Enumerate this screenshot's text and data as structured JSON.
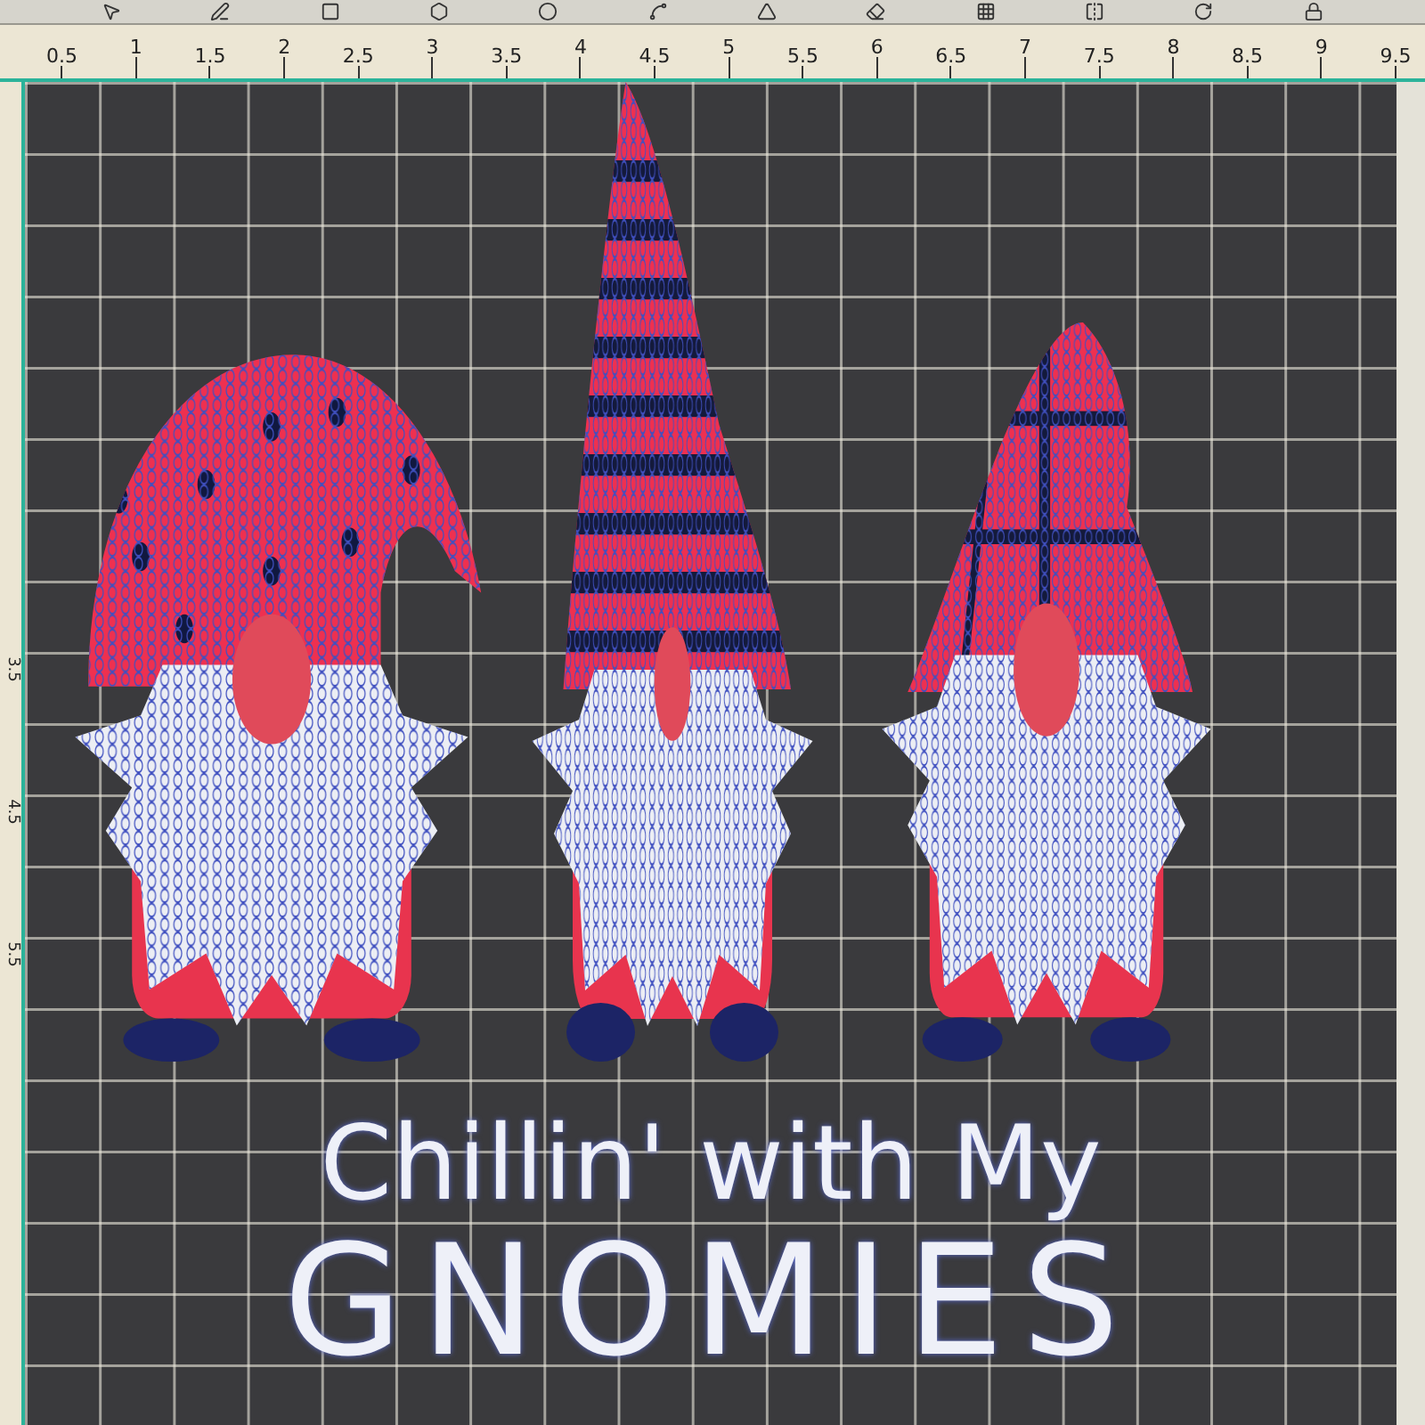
{
  "ruler": {
    "horizontal": [
      "0.5",
      "1",
      "1.5",
      "2",
      "2.5",
      "3",
      "3.5",
      "4",
      "4.5",
      "5",
      "5.5",
      "6",
      "6.5",
      "7",
      "7.5",
      "8",
      "8.5",
      "9",
      "9.5"
    ],
    "vertical": [
      "3.5",
      "4.5",
      "5.5"
    ]
  },
  "design": {
    "line_1": "Chillin' with My",
    "line_2": "GNOMIES"
  }
}
